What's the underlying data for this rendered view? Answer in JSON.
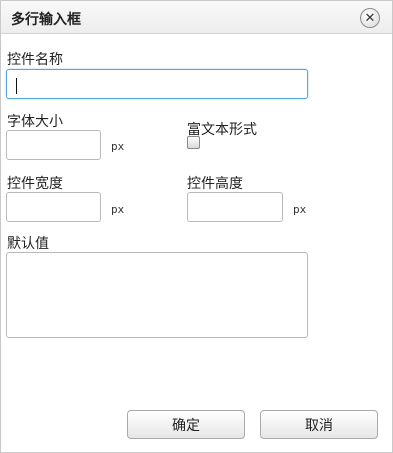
{
  "dialog": {
    "title": "多行输入框",
    "close_symbol": "✕",
    "close_icon": "close-circle-icon"
  },
  "form": {
    "control_name": {
      "label": "控件名称",
      "value": ""
    },
    "font_size": {
      "label": "字体大小",
      "value": "",
      "unit": "px"
    },
    "rich_text": {
      "label": "富文本形式",
      "checked": false
    },
    "control_width": {
      "label": "控件宽度",
      "value": "",
      "unit": "px"
    },
    "control_height": {
      "label": "控件高度",
      "value": "",
      "unit": "px"
    },
    "default_value": {
      "label": "默认值",
      "value": ""
    }
  },
  "buttons": {
    "ok_label": "确定",
    "cancel_label": "取消"
  },
  "colors": {
    "focus_border": "#5aa7d9",
    "border": "#b9b9b9"
  }
}
